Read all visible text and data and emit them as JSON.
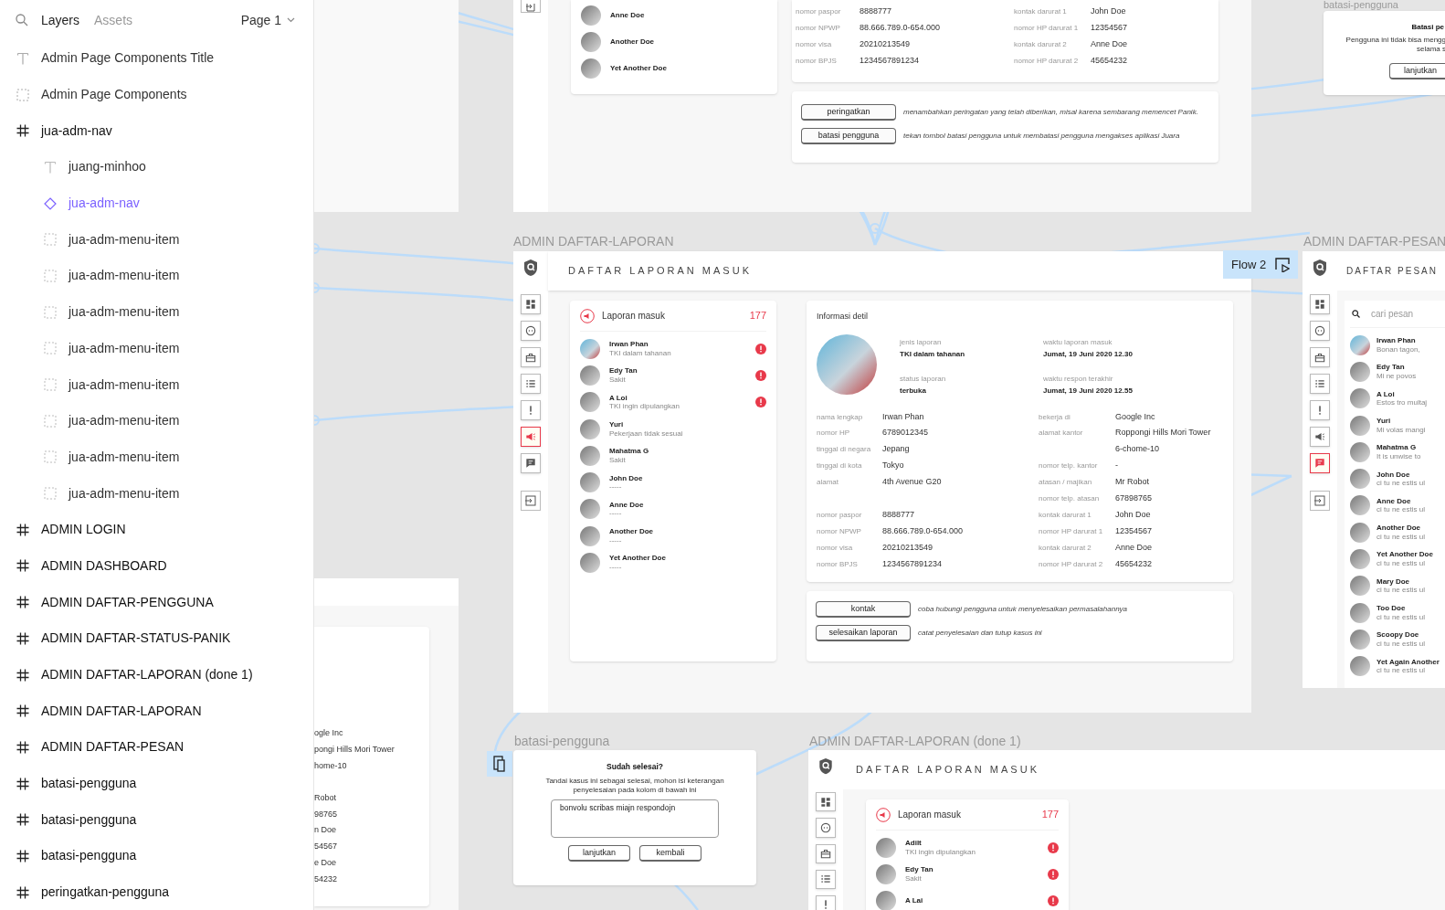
{
  "layers_panel": {
    "tabs": [
      {
        "label": "Layers",
        "selected": true
      },
      {
        "label": "Assets",
        "selected": false
      }
    ],
    "page": "Page 1",
    "layers": [
      {
        "kind": "text",
        "name": "Admin Page Components Title"
      },
      {
        "kind": "group",
        "name": "Admin Page Components"
      },
      {
        "kind": "frame",
        "name": "jua-adm-nav",
        "children": [
          {
            "kind": "text",
            "name": "juang-minhoo"
          },
          {
            "kind": "instance",
            "name": "jua-adm-nav"
          },
          {
            "kind": "group",
            "name": "jua-adm-menu-item"
          },
          {
            "kind": "group",
            "name": "jua-adm-menu-item"
          },
          {
            "kind": "group",
            "name": "jua-adm-menu-item"
          },
          {
            "kind": "group",
            "name": "jua-adm-menu-item"
          },
          {
            "kind": "group",
            "name": "jua-adm-menu-item"
          },
          {
            "kind": "group",
            "name": "jua-adm-menu-item"
          },
          {
            "kind": "group",
            "name": "jua-adm-menu-item"
          },
          {
            "kind": "group",
            "name": "jua-adm-menu-item"
          }
        ]
      },
      {
        "kind": "frame",
        "name": "ADMIN LOGIN"
      },
      {
        "kind": "frame",
        "name": "ADMIN DASHBOARD"
      },
      {
        "kind": "frame",
        "name": "ADMIN DAFTAR-PENGGUNA"
      },
      {
        "kind": "frame",
        "name": "ADMIN DAFTAR-STATUS-PANIK"
      },
      {
        "kind": "frame",
        "name": "ADMIN DAFTAR-LAPORAN (done 1)"
      },
      {
        "kind": "frame",
        "name": "ADMIN DAFTAR-LAPORAN"
      },
      {
        "kind": "frame",
        "name": "ADMIN DAFTAR-PESAN"
      },
      {
        "kind": "frame",
        "name": "batasi-pengguna"
      },
      {
        "kind": "frame",
        "name": "batasi-pengguna"
      },
      {
        "kind": "frame",
        "name": "batasi-pengguna"
      },
      {
        "kind": "frame",
        "name": "peringatkan-pengguna"
      }
    ]
  },
  "top_frame": {
    "list": [
      {
        "name": "Anne Doe"
      },
      {
        "name": "Another Doe"
      },
      {
        "name": "Yet Another Doe"
      }
    ],
    "left_fields": [
      {
        "label": "nomor paspor",
        "value": "8888777"
      },
      {
        "label": "nomor NPWP",
        "value": "88.666.789.0-654.000"
      },
      {
        "label": "nomor visa",
        "value": "20210213549"
      },
      {
        "label": "nomor BPJS",
        "value": "1234567891234"
      }
    ],
    "right_fields": [
      {
        "label": "kontak darurat 1",
        "value": "John Doe"
      },
      {
        "label": "nomor HP darurat 1",
        "value": "12354567"
      },
      {
        "label": "kontak darurat 2",
        "value": "Anne Doe"
      },
      {
        "label": "nomor HP darurat 2",
        "value": "45654232"
      }
    ],
    "actions": [
      {
        "label": "peringatkan",
        "note": "menambahkan peringatan yang telah diberikan, misal karena sembarang memencet Panik."
      },
      {
        "label": "batasi pengguna",
        "note": "tekan tombol batasi pengguna untuk membatasi pengguna mengakses aplikasi Juara"
      }
    ]
  },
  "top_dialog": {
    "label": "batasi-pengguna",
    "title": "Batasi pe",
    "lines": [
      "Pengguna ini tidak bisa mengg",
      "selama s"
    ],
    "button": "lanjutkan"
  },
  "main_frame": {
    "label": "ADMIN DAFTAR-LAPORAN",
    "header": "DAFTAR LAPORAN MASUK",
    "flow_badge": "Flow 2",
    "nav": [
      {
        "kind": "dashboard",
        "selected": false
      },
      {
        "kind": "face",
        "selected": false
      },
      {
        "kind": "briefcase",
        "selected": false
      },
      {
        "kind": "list",
        "selected": false
      },
      {
        "kind": "alert",
        "selected": false
      },
      {
        "kind": "megaphone",
        "selected": true
      },
      {
        "kind": "chat",
        "selected": false
      }
    ],
    "list": {
      "title": "Laporan masuk",
      "count": "177",
      "items": [
        {
          "name": "Irwan Phan",
          "subtitle": "TKI dalam tahanan",
          "photo": true,
          "alert": true
        },
        {
          "name": "Edy Tan",
          "subtitle": "Sakit",
          "photo": false,
          "alert": true
        },
        {
          "name": "A Loi",
          "subtitle": "TKI ingin dipulangkan",
          "photo": false,
          "alert": true
        },
        {
          "name": "Yuri",
          "subtitle": "Pekerjaan tidak sesuai",
          "photo": false,
          "alert": false
        },
        {
          "name": "Mahatma G",
          "subtitle": "Sakit",
          "photo": false,
          "alert": false
        },
        {
          "name": "John Doe",
          "subtitle": "-----",
          "photo": false,
          "alert": false
        },
        {
          "name": "Anne Doe",
          "subtitle": "-----",
          "photo": false,
          "alert": false
        },
        {
          "name": "Another Doe",
          "subtitle": "-----",
          "photo": false,
          "alert": false
        },
        {
          "name": "Yet Another Doe",
          "subtitle": "-----",
          "photo": false,
          "alert": false
        }
      ]
    },
    "detail": {
      "title": "Informasi detil",
      "meta": [
        {
          "label": "jenis laporan",
          "value": "TKI dalam tahanan"
        },
        {
          "label": "waktu laporan masuk",
          "value": "Jumat, 19 Juni 2020 12.30"
        },
        {
          "label": "status laporan",
          "value": "terbuka"
        },
        {
          "label": "waktu respon terakhir",
          "value": "Jumat, 19 Juni 2020 12.55"
        }
      ],
      "left_fields": [
        {
          "label": "nama lengkap",
          "value": "Irwan Phan"
        },
        {
          "label": "nomor HP",
          "value": "6789012345"
        },
        {
          "label": "tinggal di negara",
          "value": "Jepang"
        },
        {
          "label": "tinggal di kota",
          "value": "Tokyo"
        },
        {
          "label": "alamat",
          "value": "4th Avenue G20"
        },
        {
          "label": "nomor paspor",
          "value": "8888777"
        },
        {
          "label": "nomor NPWP",
          "value": "88.666.789.0-654.000"
        },
        {
          "label": "nomor visa",
          "value": "20210213549"
        },
        {
          "label": "nomor BPJS",
          "value": "1234567891234"
        }
      ],
      "right_fields": [
        {
          "label": "bekerja di",
          "value": "Google Inc"
        },
        {
          "label": "alamat kantor",
          "value": "Roppongi Hills Mori Tower",
          "extra": "6-chome-10"
        },
        {
          "label": "nomor telp. kantor",
          "value": "-"
        },
        {
          "label": "atasan / majikan",
          "value": "Mr Robot"
        },
        {
          "label": "nomor telp. atasan",
          "value": "67898765"
        },
        {
          "label": "kontak darurat 1",
          "value": "John Doe"
        },
        {
          "label": "nomor HP darurat 1",
          "value": "12354567"
        },
        {
          "label": "kontak darurat 2",
          "value": "Anne Doe"
        },
        {
          "label": "nomor HP darurat 2",
          "value": "45654232"
        }
      ]
    },
    "actions": [
      {
        "label": "kontak",
        "note": "coba hubungi pengguna untuk menyelesaikan permasalahannya"
      },
      {
        "label": "selesaikan laporan",
        "note": "catat penyelesaian dan tutup kasus ini"
      }
    ]
  },
  "right_frame": {
    "label": "ADMIN DAFTAR-PESAN",
    "header": "DAFTAR PESAN",
    "nav": [
      {
        "kind": "dashboard",
        "selected": false
      },
      {
        "kind": "face",
        "selected": false
      },
      {
        "kind": "briefcase",
        "selected": false
      },
      {
        "kind": "list",
        "selected": false
      },
      {
        "kind": "alert",
        "selected": false
      },
      {
        "kind": "megaphone",
        "selected": false
      },
      {
        "kind": "chat",
        "selected": true
      }
    ],
    "search_placeholder": "cari pesan",
    "messages": [
      {
        "name": "Irwan Phan",
        "text": "Bonan tagon,",
        "photo": true
      },
      {
        "name": "Edy Tan",
        "text": "Mi ne povos",
        "photo": false
      },
      {
        "name": "A Loi",
        "text": "Estos tro multaj",
        "photo": false
      },
      {
        "name": "Yuri",
        "text": "Mi volas mangi",
        "photo": false
      },
      {
        "name": "Mahatma G",
        "text": "It is unwise to",
        "photo": false
      },
      {
        "name": "John Doe",
        "text": "ci tu ne estis ul",
        "photo": false
      },
      {
        "name": "Anne Doe",
        "text": "ci tu ne estis ul",
        "photo": false
      },
      {
        "name": "Another Doe",
        "text": "ci tu ne estis ul",
        "photo": false
      },
      {
        "name": "Yet Another Doe",
        "text": "ci tu ne estis ul",
        "photo": false
      },
      {
        "name": "Mary Doe",
        "text": "ci tu ne estis ul",
        "photo": false
      },
      {
        "name": "Too Doe",
        "text": "ci tu ne estis ul",
        "photo": false
      },
      {
        "name": "Scoopy Doe",
        "text": "ci tu ne estis ul",
        "photo": false
      },
      {
        "name": "Yet Again Another",
        "text": "ci tu ne estis ul",
        "photo": false
      }
    ]
  },
  "left_fragment": {
    "values": [
      "ogle Inc",
      "pongi Hills Mori Tower",
      "home-10",
      "Robot",
      "98765",
      "n Doe",
      "54567",
      "e Doe",
      "54232"
    ]
  },
  "bottom_dialog": {
    "label": "batasi-pengguna",
    "title": "Sudah selesai?",
    "description": "Tandai kasus ini sebagai selesai, mohon isi keterangan penyelesaian pada kolom di bawah ini",
    "value": "bonvolu scribas miajn respondojn",
    "buttons": [
      "lanjutkan",
      "kembali"
    ]
  },
  "bottom_frame": {
    "label": "ADMIN DAFTAR-LAPORAN (done 1)",
    "header": "DAFTAR LAPORAN MASUK",
    "nav": [
      {
        "kind": "dashboard",
        "selected": false
      },
      {
        "kind": "face",
        "selected": false
      },
      {
        "kind": "briefcase",
        "selected": false
      },
      {
        "kind": "list",
        "selected": false
      },
      {
        "kind": "alert",
        "selected": false
      }
    ],
    "list": {
      "title": "Laporan masuk",
      "count": "177",
      "items": [
        {
          "name": "Adilt",
          "subtitle": "TKI ingin dipulangkan",
          "alert": true
        },
        {
          "name": "Edy Tan",
          "subtitle": "Sakit",
          "alert": true
        },
        {
          "name": "A Lai",
          "alert": true
        }
      ]
    }
  }
}
